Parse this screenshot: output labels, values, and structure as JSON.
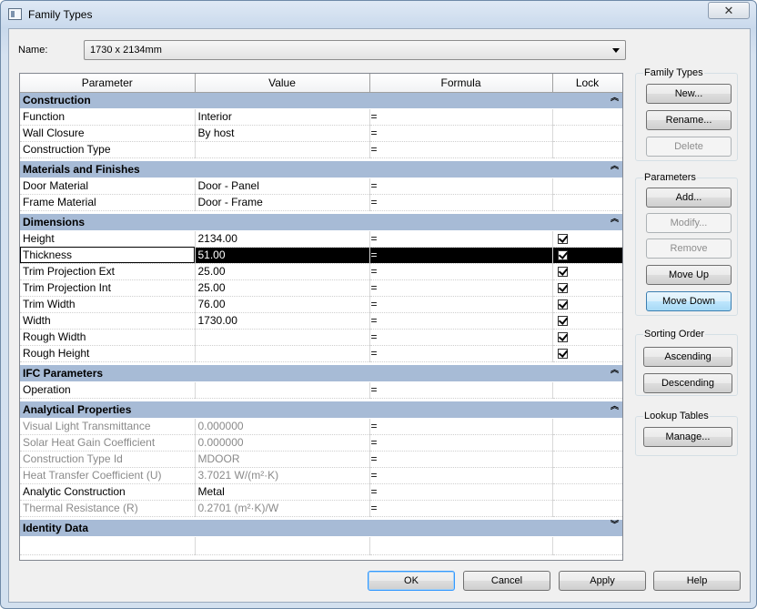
{
  "window": {
    "title": "Family Types",
    "close_glyph": "✕"
  },
  "name_field": {
    "label": "Name:",
    "value": "1730 x 2134mm"
  },
  "grid": {
    "headers": {
      "parameter": "Parameter",
      "value": "Value",
      "formula": "Formula",
      "lock": "Lock"
    },
    "groups": [
      {
        "title": "Construction",
        "state": "expanded",
        "rows": [
          {
            "param": "Function",
            "value": "Interior",
            "formula": "=",
            "lock": null
          },
          {
            "param": "Wall Closure",
            "value": "By host",
            "formula": "=",
            "lock": null
          },
          {
            "param": "Construction Type",
            "value": "",
            "formula": "=",
            "lock": null
          }
        ]
      },
      {
        "title": "Materials and Finishes",
        "state": "expanded",
        "rows": [
          {
            "param": "Door Material",
            "value": "Door - Panel",
            "formula": "=",
            "lock": null
          },
          {
            "param": "Frame Material",
            "value": "Door - Frame",
            "formula": "=",
            "lock": null
          }
        ]
      },
      {
        "title": "Dimensions",
        "state": "expanded",
        "rows": [
          {
            "param": "Height",
            "value": "2134.00",
            "formula": "=",
            "lock": true
          },
          {
            "param": "Thickness",
            "value": "51.00",
            "formula": "=",
            "lock": true,
            "selected": true
          },
          {
            "param": "Trim Projection Ext",
            "value": "25.00",
            "formula": "=",
            "lock": true
          },
          {
            "param": "Trim Projection Int",
            "value": "25.00",
            "formula": "=",
            "lock": true
          },
          {
            "param": "Trim Width",
            "value": "76.00",
            "formula": "=",
            "lock": true
          },
          {
            "param": "Width",
            "value": "1730.00",
            "formula": "=",
            "lock": true
          },
          {
            "param": "Rough Width",
            "value": "",
            "formula": "=",
            "lock": true
          },
          {
            "param": "Rough Height",
            "value": "",
            "formula": "=",
            "lock": true
          }
        ]
      },
      {
        "title": "IFC Parameters",
        "state": "expanded",
        "rows": [
          {
            "param": "Operation",
            "value": "",
            "formula": "=",
            "lock": null
          }
        ]
      },
      {
        "title": "Analytical Properties",
        "state": "expanded",
        "rows": [
          {
            "param": "Visual Light Transmittance",
            "value": "0.000000",
            "formula": "=",
            "lock": null,
            "readonly": true
          },
          {
            "param": "Solar Heat Gain Coefficient",
            "value": "0.000000",
            "formula": "=",
            "lock": null,
            "readonly": true
          },
          {
            "param": "Construction Type Id",
            "value": "MDOOR",
            "formula": "=",
            "lock": null,
            "readonly": true
          },
          {
            "param": "Heat Transfer Coefficient (U)",
            "value": "3.7021 W/(m²·K)",
            "formula": "=",
            "lock": null,
            "readonly": true
          },
          {
            "param": "Analytic Construction",
            "value": "Metal",
            "formula": "=",
            "lock": null
          },
          {
            "param": "Thermal Resistance (R)",
            "value": "0.2701 (m²·K)/W",
            "formula": "=",
            "lock": null,
            "readonly": true
          }
        ]
      },
      {
        "title": "Identity Data",
        "state": "collapsed",
        "rows": []
      }
    ],
    "chevrons": {
      "expanded": "︽",
      "collapsed": "︾"
    }
  },
  "sidebar": {
    "family_types": {
      "title": "Family Types",
      "new": "New...",
      "rename": "Rename...",
      "delete": "Delete"
    },
    "parameters": {
      "title": "Parameters",
      "add": "Add...",
      "modify": "Modify...",
      "remove": "Remove",
      "move_up": "Move Up",
      "move_down": "Move Down"
    },
    "sorting": {
      "title": "Sorting Order",
      "ascending": "Ascending",
      "descending": "Descending"
    },
    "lookup": {
      "title": "Lookup Tables",
      "manage": "Manage..."
    }
  },
  "footer": {
    "ok": "OK",
    "cancel": "Cancel",
    "apply": "Apply",
    "help": "Help"
  }
}
